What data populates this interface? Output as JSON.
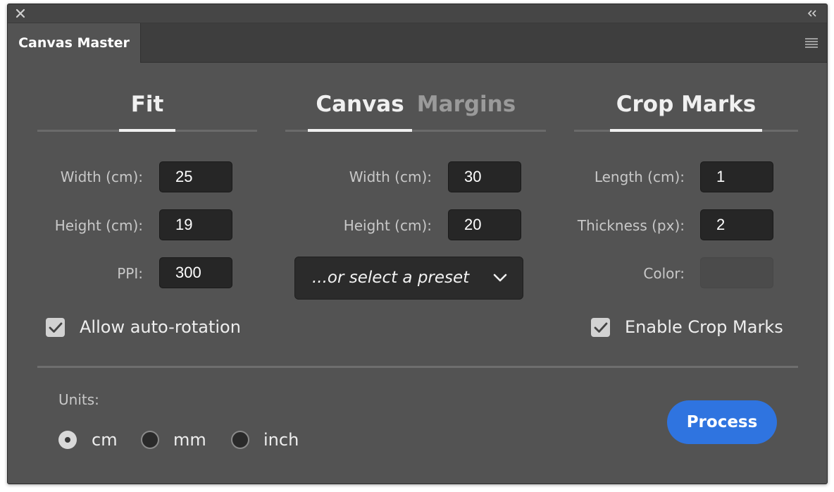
{
  "panel": {
    "tab_title": "Canvas Master"
  },
  "fit": {
    "tab_label": "Fit",
    "width_label": "Width (cm):",
    "width_value": "25",
    "height_label": "Height (cm):",
    "height_value": "19",
    "ppi_label": "PPI:",
    "ppi_value": "300",
    "auto_rotation_label": "Allow auto-rotation",
    "auto_rotation_checked": true
  },
  "canvas": {
    "tabs": [
      {
        "label": "Canvas",
        "active": true
      },
      {
        "label": "Margins",
        "active": false
      }
    ],
    "width_label": "Width (cm):",
    "width_value": "30",
    "height_label": "Height (cm):",
    "height_value": "20",
    "preset_placeholder": "...or select a preset"
  },
  "crop_marks": {
    "tab_label": "Crop Marks",
    "length_label": "Length (cm):",
    "length_value": "1",
    "thickness_label": "Thickness (px):",
    "thickness_value": "2",
    "color_label": "Color:",
    "color_value": "#4b4b4b",
    "enable_label": "Enable Crop Marks",
    "enable_checked": true
  },
  "units": {
    "label": "Units:",
    "options": [
      {
        "label": "cm",
        "selected": true
      },
      {
        "label": "mm",
        "selected": false
      },
      {
        "label": "inch",
        "selected": false
      }
    ]
  },
  "actions": {
    "process_label": "Process",
    "process_color": "#2f74e0"
  },
  "icons": {
    "close": "close-icon",
    "collapse": "double-chevron-left-icon",
    "menu": "hamburger-menu-icon",
    "dropdown": "chevron-down-icon",
    "checkbox": "checkmark-icon"
  }
}
